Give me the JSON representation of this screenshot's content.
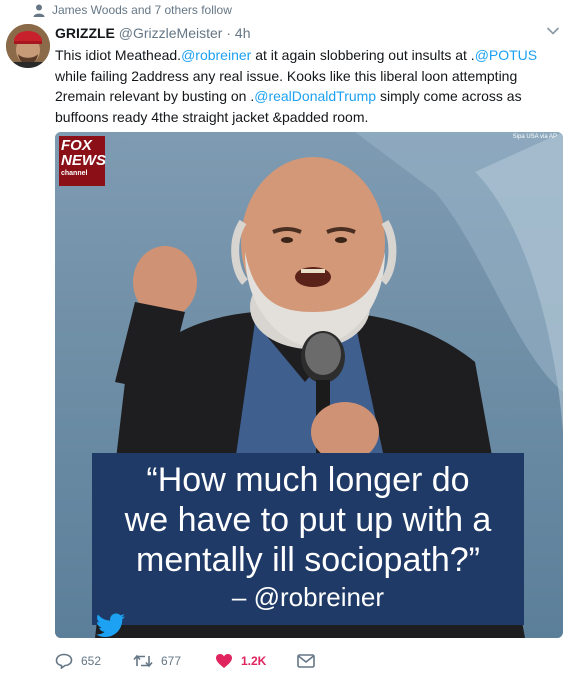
{
  "social_context": {
    "text": "James Woods and 7 others follow",
    "icon": "person-icon"
  },
  "tweet": {
    "display_name": "GRIZZLE",
    "handle": "@GrizzleMeister",
    "separator": "·",
    "time": "4h",
    "text_parts": {
      "p1": "This idiot Meathead.",
      "m1": "@robreiner",
      "p2": " at it again slobbering out insults at .",
      "m2": "@POTUS",
      "p3": " while failing 2address any real issue. Kooks like this liberal loon attempting 2remain relevant by busting on .",
      "m3": "@realDonaldTrump",
      "p4": " simply come across as buffoons ready 4the straight jacket &padded room."
    },
    "media": {
      "logo_line1": "FOX",
      "logo_line2": "NEWS",
      "logo_line3": "channel",
      "credit": "Sipa USA via AP",
      "quote_lines": [
        "“How much longer do",
        "we have to put up with a",
        "mentally ill sociopath?”"
      ],
      "attribution": "– @robreiner"
    },
    "actions": {
      "reply_count": "652",
      "retweet_count": "677",
      "like_count": "1.2K"
    }
  },
  "colors": {
    "link": "#1da1f2",
    "like": "#e0245e",
    "muted": "#657786",
    "quote_bg": "#1f3a67"
  }
}
